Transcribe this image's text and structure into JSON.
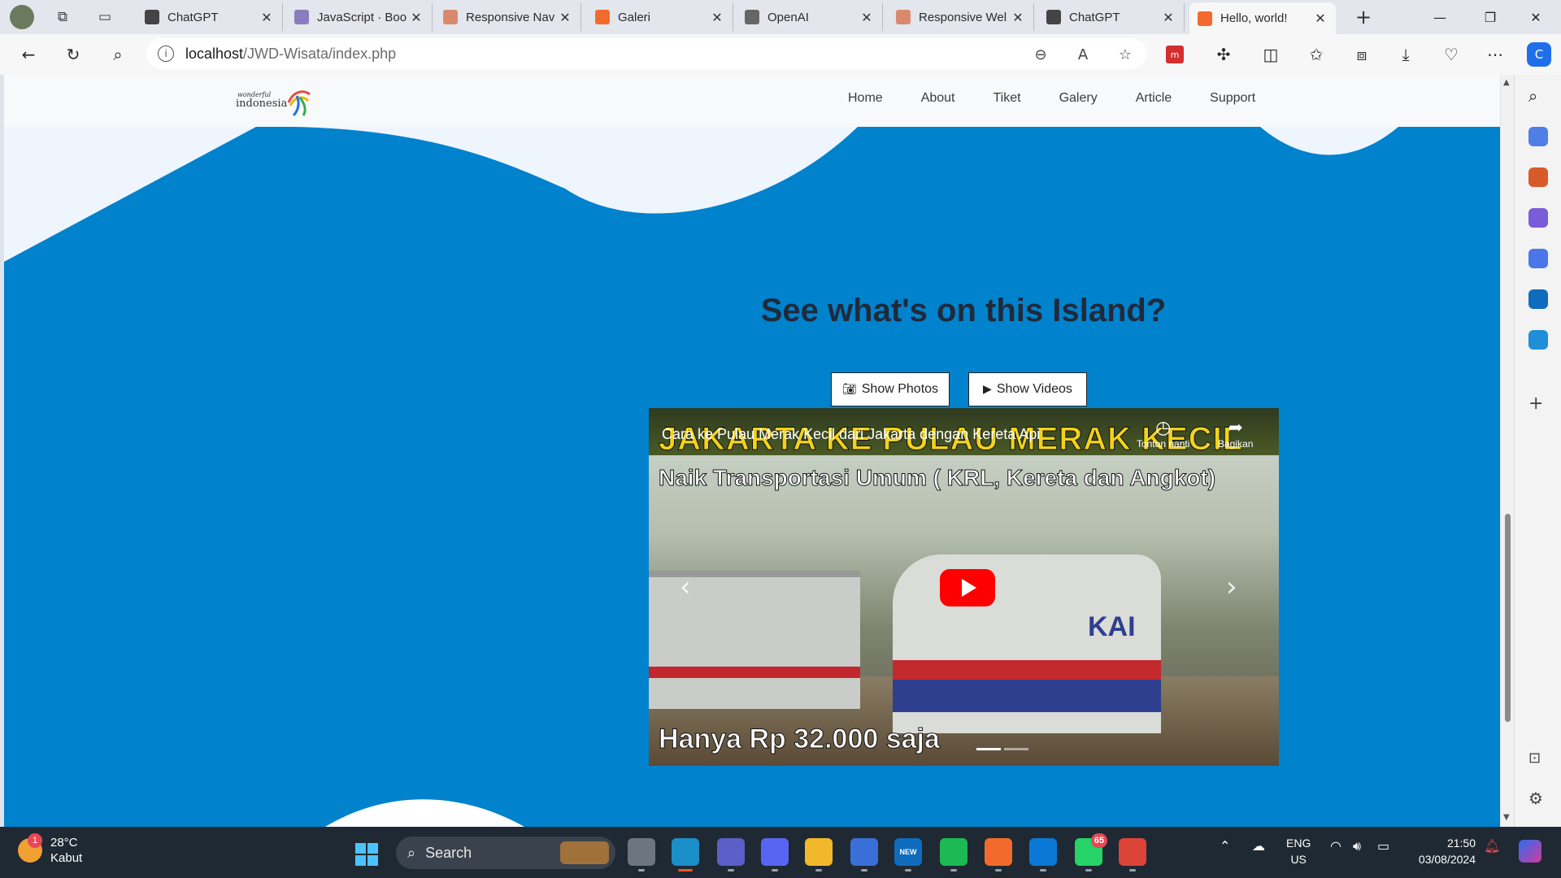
{
  "browser": {
    "tabs": [
      {
        "title": "ChatGPT",
        "icon": "chatgpt-icon",
        "color": "#444444"
      },
      {
        "title": "JavaScript · Boo",
        "icon": "bootstrap-icon",
        "color": "#8b7dbd"
      },
      {
        "title": "Responsive Nav",
        "icon": "sparkle-icon",
        "color": "#d98a6e"
      },
      {
        "title": "Galeri",
        "icon": "xampp-icon",
        "color": "#f26b2c"
      },
      {
        "title": "OpenAI",
        "icon": "document-icon",
        "color": "#666666"
      },
      {
        "title": "Responsive Wel",
        "icon": "sparkle-icon",
        "color": "#d98a6e"
      },
      {
        "title": "ChatGPT",
        "icon": "chatgpt-icon",
        "color": "#444444"
      },
      {
        "title": "Hello, world!",
        "icon": "xampp-icon",
        "color": "#f26b2c"
      }
    ],
    "active_tab": 7,
    "url_host": "localhost",
    "url_path": "/JWD-Wisata/index.php"
  },
  "site": {
    "logo_small": "wonderful",
    "logo_big": "indonesia",
    "nav": [
      "Home",
      "About",
      "Tiket",
      "Galery",
      "Article",
      "Support"
    ],
    "section_title": "See what's on this Island?",
    "btn_photos": "Show Photos",
    "btn_videos": "Show Videos",
    "colors": {
      "section_bg": "#0082cc",
      "nav_bg": "#f8f9fa",
      "wave": "#eef5fc"
    }
  },
  "video": {
    "title": "Cara ke Pulau Merak Kecil dari Jakarta dengan Kereta Api",
    "banner": "JAKARTA KE PULAU MERAK KECIL",
    "subtitle": "Naik Transportasi Umum ( KRL, Kereta dan Angkot)",
    "price": "Hanya Rp 32.000 saja",
    "watch_later": "Tonton nanti",
    "share": "Bagikan",
    "train_logo": "KAI",
    "slide_count": 2,
    "active_slide": 0
  },
  "taskbar": {
    "weather_temp": "28°C",
    "weather_cond": "Kabut",
    "weather_badge": "1",
    "search": "Search",
    "apps": [
      {
        "name": "task-view",
        "color": "#6c7580",
        "label": ""
      },
      {
        "name": "edge",
        "color": "#1a8fc8",
        "label": "",
        "active": true
      },
      {
        "name": "teams",
        "color": "#5b5fc7",
        "label": ""
      },
      {
        "name": "discord",
        "color": "#5865f2",
        "label": ""
      },
      {
        "name": "file-explorer",
        "color": "#f2b82b",
        "label": ""
      },
      {
        "name": "clipchamp",
        "color": "#3b6fd8",
        "label": ""
      },
      {
        "name": "outlook",
        "color": "#0f6cbd",
        "label": "NEW"
      },
      {
        "name": "spotify",
        "color": "#1db954",
        "label": ""
      },
      {
        "name": "xampp",
        "color": "#f26b2c",
        "label": ""
      },
      {
        "name": "vscode",
        "color": "#0a78d4",
        "label": ""
      },
      {
        "name": "whatsapp",
        "color": "#25d366",
        "label": "",
        "count": "65"
      },
      {
        "name": "chrome",
        "color": "#db4437",
        "label": ""
      }
    ],
    "lang_top": "ENG",
    "lang_bottom": "US",
    "time": "21:50",
    "date": "03/08/2024"
  }
}
